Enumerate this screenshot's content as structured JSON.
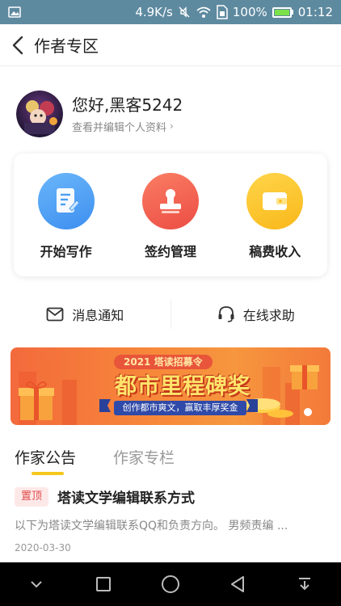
{
  "status_bar": {
    "speed": "4.9K/s",
    "battery_percent": "100%",
    "time": "01:12",
    "icons": [
      "gallery-icon",
      "mute-icon",
      "wifi-icon",
      "sim-icon",
      "battery-icon"
    ]
  },
  "header": {
    "title": "作者专区"
  },
  "profile": {
    "greeting": "您好,黑客5242",
    "edit_link": "查看并编辑个人资料"
  },
  "actions": [
    {
      "label": "开始写作",
      "icon": "write-icon",
      "color": "#4a9ef2"
    },
    {
      "label": "签约管理",
      "icon": "stamp-icon",
      "color": "#f05a4a"
    },
    {
      "label": "稿费收入",
      "icon": "wallet-icon",
      "color": "#fcc72a"
    }
  ],
  "help_row": {
    "messages": "消息通知",
    "support": "在线求助"
  },
  "banner": {
    "tag": "2021 塔读招募令",
    "headline": "都市里程碑奖",
    "subtitle": "创作都市爽文，赢取丰厚奖金"
  },
  "tabs": [
    {
      "label": "作家公告",
      "active": true
    },
    {
      "label": "作家专栏",
      "active": false
    }
  ],
  "notice": {
    "pin": "置顶",
    "title": "塔读文学编辑联系方式",
    "summary": "以下为塔读文学编辑联系QQ和负责方向。 男频责编 ...",
    "date": "2020-03-30"
  },
  "colors": {
    "status_bar": "#5e8aa0",
    "accent_yellow": "#f6c71c",
    "pin_red": "#e24a4a"
  }
}
